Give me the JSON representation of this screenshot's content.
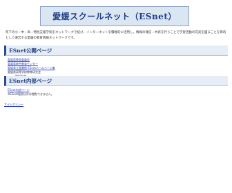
{
  "header": {
    "title": "愛媛スクールネット（ESnet）"
  },
  "intro": {
    "text": "県下の小・中・高・特別支援学校をネットワークで結び，インターネットを積極的に活用し，情報の発信・共有を行うことで学習活動の充実を図ることを目的として運営する愛媛の教育情報ネットワークです。"
  },
  "public_section": {
    "heading": "ESnet公開ページ",
    "links": [
      {
        "label": "愛媛県教育委員会",
        "type": "link"
      },
      {
        "label": "愛媛県総合教育センター",
        "type": "link"
      },
      {
        "label": "愛媛県立図書館 ESnetホームページ集",
        "type": "link"
      },
      {
        "label": "愛媛県高等学校教育研究会",
        "type": "plain"
      },
      {
        "label": "理科部会",
        "type": "sub"
      },
      {
        "label": "家庭科部会",
        "type": "sub"
      }
    ]
  },
  "private_section": {
    "heading": "ESnet内部ページ",
    "links": [
      {
        "label": "ESnet内部ページ",
        "type": "link"
      },
      {
        "label": "※ESnet接続以外は閲覧できません。",
        "type": "plain"
      }
    ]
  },
  "footer": {
    "link_label": "サイトポリシー"
  }
}
